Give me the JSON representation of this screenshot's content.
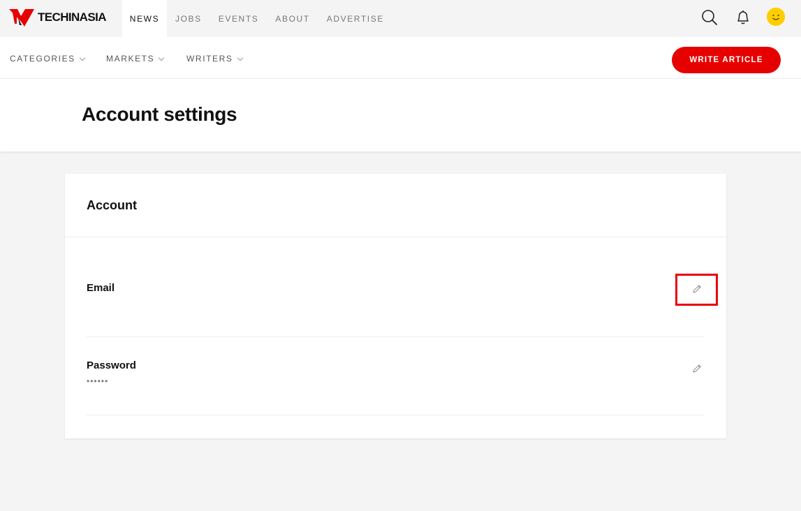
{
  "brand": {
    "name": "TECHINASIA",
    "accent": "#e60000"
  },
  "nav": {
    "items": [
      {
        "label": "NEWS",
        "active": true
      },
      {
        "label": "JOBS",
        "active": false
      },
      {
        "label": "EVENTS",
        "active": false
      },
      {
        "label": "ABOUT",
        "active": false
      },
      {
        "label": "ADVERTISE",
        "active": false
      }
    ]
  },
  "icons": {
    "search": "search-icon",
    "notifications": "bell-icon",
    "avatar": "smiley-avatar"
  },
  "subnav": {
    "items": [
      {
        "label": "CATEGORIES"
      },
      {
        "label": "MARKETS"
      },
      {
        "label": "WRITERS"
      }
    ],
    "write_button": "WRITE ARTICLE"
  },
  "page": {
    "title": "Account settings"
  },
  "account": {
    "section_title": "Account",
    "email": {
      "label": "Email",
      "value": ""
    },
    "password": {
      "label": "Password",
      "value": "••••••"
    }
  },
  "colors": {
    "highlight": "#e8000d",
    "avatar": "#ffce00"
  }
}
